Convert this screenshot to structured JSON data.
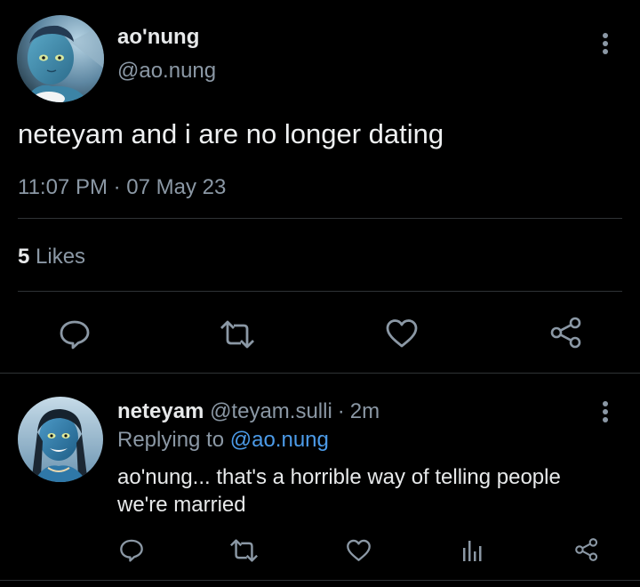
{
  "main_tweet": {
    "display_name": "ao'nung",
    "handle": "@ao.nung",
    "text": "neteyam and i are no longer dating",
    "timestamp": "11:07 PM · 07 May 23",
    "likes_count": "5",
    "likes_label": "Likes"
  },
  "reply": {
    "display_name": "neteyam",
    "handle": "@teyam.sulli",
    "separator": "·",
    "time": "2m",
    "replying_prefix": "Replying to",
    "replying_handle": "@ao.nung",
    "text_line1": "ao'nung... that's a horrible way of telling people",
    "text_line2": "we're married"
  },
  "colors": {
    "background": "#000000",
    "text": "#e7e9ea",
    "muted": "#8b98a5",
    "link": "#4c9be8",
    "divider": "#2f3336"
  },
  "icons": {
    "main_actions": [
      "reply-icon",
      "retweet-icon",
      "like-icon",
      "share-icon"
    ],
    "reply_actions": [
      "reply-icon",
      "retweet-icon",
      "like-icon",
      "analytics-icon",
      "share-icon"
    ],
    "menu": "more-vertical-icon"
  }
}
